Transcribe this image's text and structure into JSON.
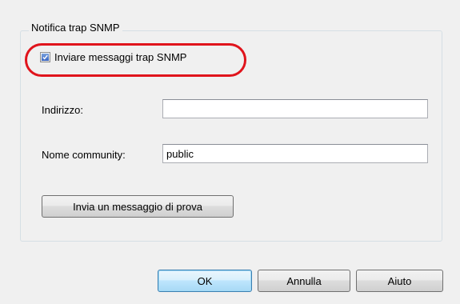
{
  "groupbox": {
    "title": "Notifica trap SNMP",
    "checkbox_label": "Inviare messaggi trap SNMP",
    "checkbox_checked": true,
    "address_label": "Indirizzo:",
    "address_value": "",
    "community_label": "Nome community:",
    "community_value": "public",
    "test_button": "Invia un messaggio di prova"
  },
  "footer": {
    "ok": "OK",
    "cancel": "Annulla",
    "help": "Aiuto"
  },
  "highlight_color": "#e0141c"
}
